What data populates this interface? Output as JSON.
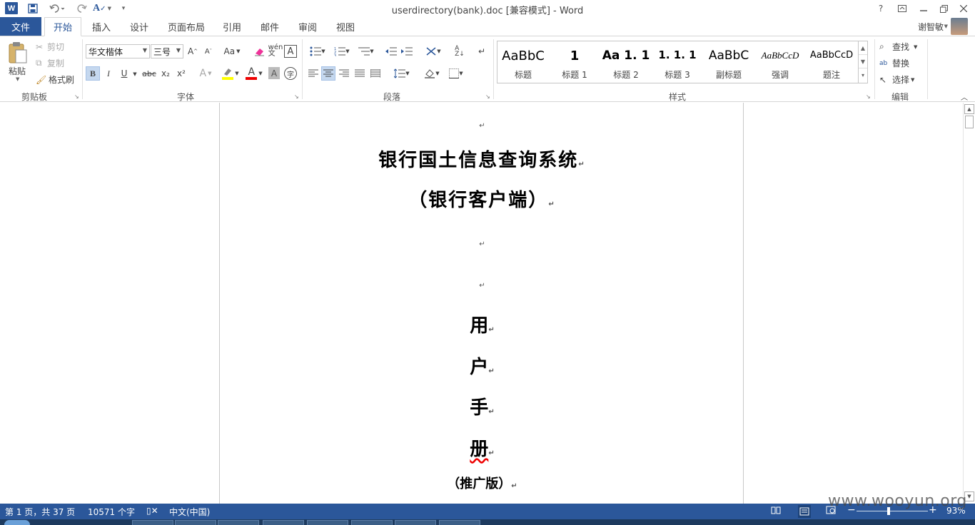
{
  "window": {
    "title": "userdirectory(bank).doc [兼容模式] - Word",
    "help": "?",
    "controls": [
      "▣",
      "—",
      "❐",
      "✕"
    ]
  },
  "qat": {
    "logo": "W",
    "save_icon": "save-icon",
    "undo_icon": "undo-icon",
    "redo_icon": "redo-icon"
  },
  "tabs": {
    "file": "文件",
    "items": [
      "开始",
      "插入",
      "设计",
      "页面布局",
      "引用",
      "邮件",
      "审阅",
      "视图"
    ]
  },
  "user": {
    "name": "谢智敏"
  },
  "clipboard": {
    "paste": "粘贴",
    "cut": "剪切",
    "copy": "复制",
    "format_painter": "格式刷",
    "label": "剪贴板"
  },
  "font": {
    "family": "华文楷体",
    "size": "三号",
    "label": "字体",
    "bold": "B",
    "italic": "I",
    "underline": "U",
    "strike": "abc",
    "sub": "x₂",
    "sup": "x²",
    "grow": "A",
    "shrink": "A",
    "case": "Aa"
  },
  "paragraph": {
    "label": "段落"
  },
  "styles": {
    "label": "样式",
    "items": [
      {
        "sample": "AaBbC",
        "name": "标题"
      },
      {
        "sample": "1",
        "name": "标题 1"
      },
      {
        "sample": "Aa  1. 1",
        "name": "标题 2"
      },
      {
        "sample": "1. 1. 1",
        "name": "标题 3"
      },
      {
        "sample": "AaBbC",
        "name": "副标题"
      },
      {
        "sample": "AaBbCcD",
        "name": "强调"
      },
      {
        "sample": "AaBbCcD",
        "name": "题注"
      }
    ]
  },
  "editing": {
    "label": "编辑",
    "find": "查找",
    "replace": "替换",
    "select": "选择"
  },
  "document": {
    "title": "银行国土信息查询系统",
    "subtitle": "（银行客户端）",
    "vertical": [
      "用",
      "户",
      "手",
      "册"
    ],
    "edition": "（推广版）",
    "mark": "↵"
  },
  "status": {
    "page": "第 1 页，共 37 页",
    "words": "10571 个字",
    "language": "中文(中国)",
    "zoom": "93%",
    "zoom_minus": "−",
    "zoom_plus": "+"
  },
  "watermark": "www.wooyun.org",
  "colors": {
    "accent": "#2b579a",
    "highlight": "#c5d8ef"
  }
}
